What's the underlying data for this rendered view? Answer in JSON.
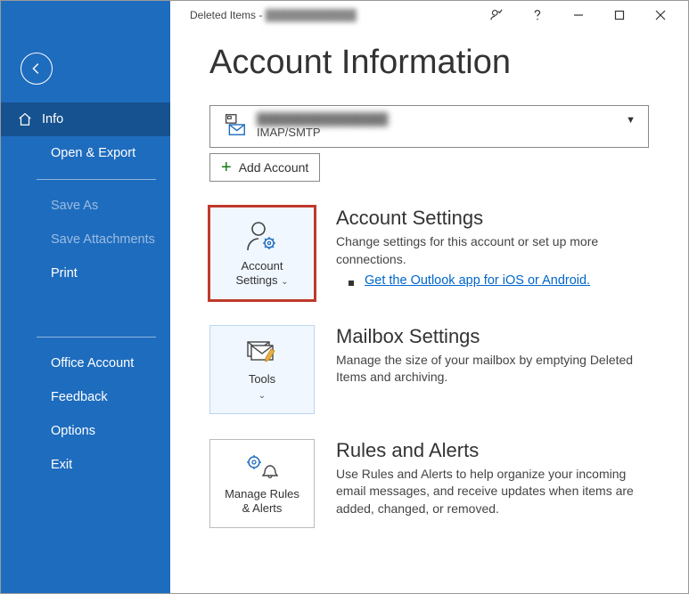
{
  "titlebar": {
    "prefix": "Deleted Items - ",
    "account_blurred": "████████████"
  },
  "sidebar": {
    "info": "Info",
    "open_export": "Open & Export",
    "save_as": "Save As",
    "save_attachments": "Save Attachments",
    "print": "Print",
    "office_account": "Office Account",
    "feedback": "Feedback",
    "options": "Options",
    "exit": "Exit"
  },
  "page": {
    "title": "Account Information"
  },
  "account_selector": {
    "email_blurred": "████████████████",
    "protocol": "IMAP/SMTP"
  },
  "add_account": "Add Account",
  "tiles": {
    "account_settings": "Account\nSettings",
    "tools": "Tools",
    "manage_rules": "Manage Rules\n& Alerts"
  },
  "sections": {
    "account_settings": {
      "title": "Account Settings",
      "desc": "Change settings for this account or set up more connections.",
      "link": "Get the Outlook app for iOS or Android."
    },
    "mailbox_settings": {
      "title": "Mailbox Settings",
      "desc": "Manage the size of your mailbox by emptying Deleted Items and archiving."
    },
    "rules_alerts": {
      "title": "Rules and Alerts",
      "desc": "Use Rules and Alerts to help organize your incoming email messages, and receive updates when items are added, changed, or removed."
    }
  }
}
